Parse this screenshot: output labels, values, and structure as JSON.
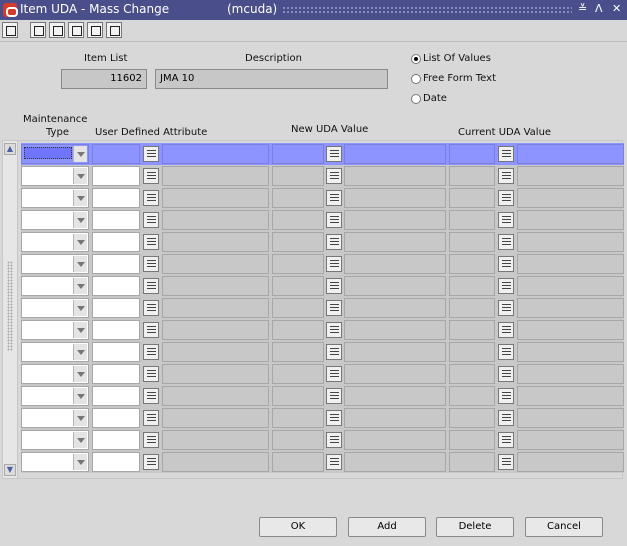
{
  "window": {
    "title": "Item UDA - Mass Change",
    "user": "(mcuda)",
    "controls": [
      "≚",
      "ᐱ",
      "✕"
    ]
  },
  "toolbar": [
    "home",
    "world",
    "help-book",
    "clipboard",
    "print",
    "help"
  ],
  "form": {
    "item_list_label": "Item List",
    "item_list_value": "11602",
    "description_label": "Description",
    "description_value": "JMA 10",
    "radios": [
      {
        "label": "List Of Values",
        "selected": true
      },
      {
        "label": "Free Form Text",
        "selected": false
      },
      {
        "label": "Date",
        "selected": false
      }
    ]
  },
  "grid": {
    "headers": {
      "maintenance": "Maintenance",
      "type": "Type",
      "uda": "User Defined Attribute",
      "new": "New UDA Value",
      "current": "Current UDA Value"
    },
    "rows": 15
  },
  "buttons": {
    "ok": "OK",
    "add": "Add",
    "delete": "Delete",
    "cancel": "Cancel"
  },
  "colors": {
    "titlebar": "#4a4f8c",
    "selected_row": "#8d94ff"
  }
}
